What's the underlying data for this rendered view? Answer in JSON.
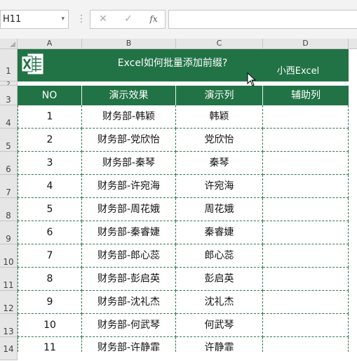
{
  "formula_bar": {
    "name_box": "H11",
    "name_box_dropdown": "▾",
    "separator": "⋮",
    "cancel_glyph": "✕",
    "enter_glyph": "✓",
    "fx_glyph": "fx",
    "formula": ""
  },
  "columns": [
    "A",
    "B",
    "C",
    "D"
  ],
  "rows": [
    "1",
    "2",
    "3",
    "4",
    "5",
    "6",
    "7",
    "8",
    "9",
    "10",
    "11",
    "12",
    "13",
    "14"
  ],
  "banner": {
    "title": "Excel如何批量添加前缀?",
    "brand": "小西Excel",
    "color": "#217346"
  },
  "table": {
    "headers": [
      "NO",
      "演示效果",
      "演示列",
      "辅助列"
    ],
    "rows": [
      {
        "no": "1",
        "effect": "财务部-韩颖",
        "name": "韩颖",
        "aux": ""
      },
      {
        "no": "2",
        "effect": "财务部-党欣怡",
        "name": "党欣怡",
        "aux": ""
      },
      {
        "no": "3",
        "effect": "财务部-秦琴",
        "name": "秦琴",
        "aux": ""
      },
      {
        "no": "4",
        "effect": "财务部-许宛海",
        "name": "许宛海",
        "aux": ""
      },
      {
        "no": "5",
        "effect": "财务部-周花娥",
        "name": "周花娥",
        "aux": ""
      },
      {
        "no": "6",
        "effect": "财务部-秦睿婕",
        "name": "秦睿婕",
        "aux": ""
      },
      {
        "no": "7",
        "effect": "财务部-郎心蕊",
        "name": "郎心蕊",
        "aux": ""
      },
      {
        "no": "8",
        "effect": "财务部-彭启英",
        "name": "彭启英",
        "aux": ""
      },
      {
        "no": "9",
        "effect": "财务部-沈礼杰",
        "name": "沈礼杰",
        "aux": ""
      },
      {
        "no": "10",
        "effect": "财务部-何武琴",
        "name": "何武琴",
        "aux": ""
      },
      {
        "no": "11",
        "effect": "财务部-许静霏",
        "name": "许静霏",
        "aux": ""
      }
    ]
  }
}
